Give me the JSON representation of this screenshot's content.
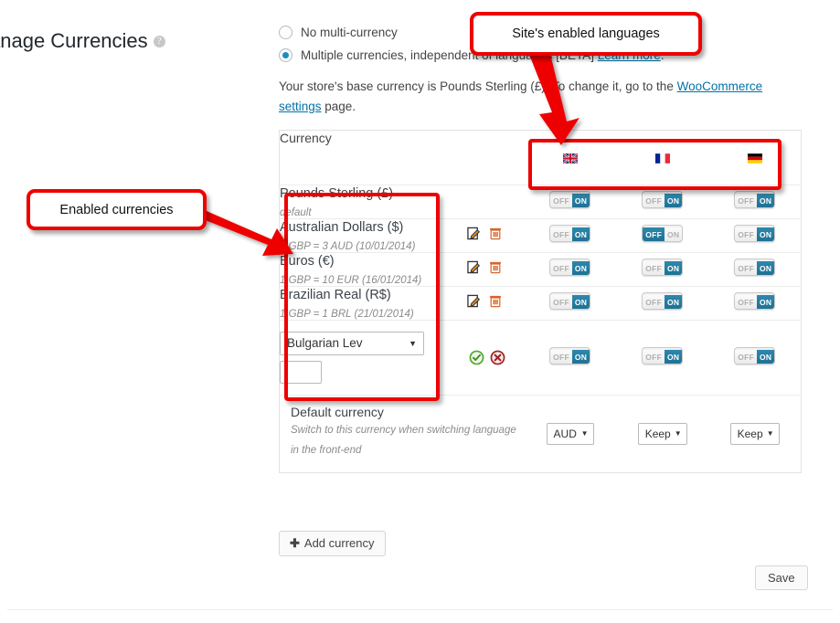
{
  "page": {
    "title": "anage Currencies",
    "help_icon": "?"
  },
  "options": {
    "radio_none": {
      "label": "No multi-currency",
      "selected": false
    },
    "radio_multi": {
      "label": "Multiple currencies, independent of languages [BETA]",
      "link": "Learn more",
      "period": ".",
      "selected": true
    }
  },
  "description": {
    "part1": "Your store's base currency is Pounds Sterling (£). To change it, go to the ",
    "link": "WooCommerce settings",
    "part2": " page."
  },
  "table": {
    "header": {
      "currency_label": "Currency",
      "languages": [
        {
          "name": "English",
          "flag": "uk-flag"
        },
        {
          "name": "French",
          "flag": "france-flag"
        },
        {
          "name": "German",
          "flag": "germany-flag"
        }
      ]
    },
    "rows": [
      {
        "name": "Pounds Sterling (£)",
        "sub": "default",
        "has_actions": false,
        "toggles": [
          "ON",
          "ON",
          "ON"
        ]
      },
      {
        "name": "Australian Dollars ($)",
        "sub": "1 GBP = 3 AUD (10/01/2014)",
        "has_actions": true,
        "toggles": [
          "ON",
          "OFF",
          "ON"
        ]
      },
      {
        "name": "Euros (€)",
        "sub": "1 GBP = 10 EUR (16/01/2014)",
        "has_actions": true,
        "toggles": [
          "ON",
          "ON",
          "ON"
        ]
      },
      {
        "name": "Brazilian Real (R$)",
        "sub": "1 GBP = 1 BRL (21/01/2014)",
        "has_actions": true,
        "toggles": [
          "ON",
          "ON",
          "ON"
        ]
      }
    ],
    "new_row": {
      "select_value": "Bulgarian Lev",
      "rate_value": "",
      "confirm_icon": "check-circle-icon",
      "cancel_icon": "cancel-circle-icon",
      "toggles": [
        "ON",
        "ON",
        "ON"
      ]
    },
    "default_row": {
      "title": "Default currency",
      "sub_line1": "Switch to this currency when switching language",
      "sub_line2": "in the front-end",
      "selects": [
        "AUD",
        "Keep",
        "Keep"
      ]
    }
  },
  "buttons": {
    "add_currency": "Add currency",
    "add_currency_icon": "plus-icon",
    "save": "Save"
  },
  "annotations": {
    "languages": "Site's enabled languages",
    "currencies": "Enabled currencies"
  },
  "colors": {
    "accent_blue": "#1d6e91",
    "link_blue": "#0073aa",
    "annotation_red": "#ee0000",
    "delete_orange": "#d9652b"
  }
}
